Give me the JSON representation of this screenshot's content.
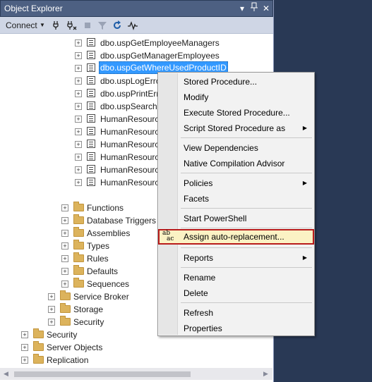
{
  "titlebar": {
    "title": "Object Explorer",
    "pin_glyph": "▾",
    "pin2_glyph": "⊣",
    "close_glyph": "✕"
  },
  "toolbar": {
    "connect_label": "Connect",
    "icons": [
      "connect-icon",
      "disconnect-icon",
      "stop-icon",
      "filter-icon",
      "refresh-icon",
      "activity-monitor-icon"
    ]
  },
  "tree": {
    "items": [
      {
        "label": "dbo.uspGetEmployeeManagers",
        "type": "sp"
      },
      {
        "label": "dbo.uspGetManagerEmployees",
        "type": "sp"
      },
      {
        "label": "dbo.uspGetWhereUsedProductID",
        "type": "sp",
        "selected": true
      },
      {
        "label": "dbo.uspLogErro",
        "type": "sp"
      },
      {
        "label": "dbo.uspPrintErr",
        "type": "sp"
      },
      {
        "label": "dbo.uspSearchC",
        "type": "sp"
      },
      {
        "label": "HumanResourc",
        "type": "sp"
      },
      {
        "label": "HumanResourc",
        "type": "sp"
      },
      {
        "label": "HumanResourc",
        "type": "sp"
      },
      {
        "label": "HumanResourc",
        "type": "sp"
      },
      {
        "label": "HumanResourc",
        "type": "sp"
      },
      {
        "label": "HumanResourc",
        "type": "sp"
      },
      {
        "label": "Functions",
        "type": "folder"
      },
      {
        "label": "Database Triggers",
        "type": "folder"
      },
      {
        "label": "Assemblies",
        "type": "folder"
      },
      {
        "label": "Types",
        "type": "folder"
      },
      {
        "label": "Rules",
        "type": "folder"
      },
      {
        "label": "Defaults",
        "type": "folder"
      },
      {
        "label": "Sequences",
        "type": "folder"
      },
      {
        "label": "Service Broker",
        "type": "folder"
      },
      {
        "label": "Storage",
        "type": "folder"
      },
      {
        "label": "Security",
        "type": "folder"
      },
      {
        "label": "Security",
        "type": "folder"
      },
      {
        "label": "Server Objects",
        "type": "folder"
      },
      {
        "label": "Replication",
        "type": "folder"
      }
    ],
    "expand_glyph": "+"
  },
  "menu": {
    "items": [
      {
        "label": "Stored Procedure..."
      },
      {
        "label": "Modify"
      },
      {
        "label": "Execute Stored Procedure..."
      },
      {
        "label": "Script Stored Procedure as",
        "submenu": true
      },
      {
        "label": "View Dependencies"
      },
      {
        "label": "Native Compilation Advisor"
      },
      {
        "label": "Policies",
        "submenu": true
      },
      {
        "label": "Facets"
      },
      {
        "label": "Start PowerShell"
      },
      {
        "label": "Assign auto-replacement...",
        "highlighted": true,
        "icon": "abc-replace-icon"
      },
      {
        "label": "Reports",
        "submenu": true
      },
      {
        "label": "Rename"
      },
      {
        "label": "Delete"
      },
      {
        "label": "Refresh"
      },
      {
        "label": "Properties"
      }
    ],
    "submenu_glyph": "▶",
    "icon_glyph_top": "ab",
    "icon_glyph_bottom": "ac"
  },
  "colors": {
    "selection": "#3399ff",
    "highlight_border": "#b91c1c",
    "highlight_fill": "#fbf2c4",
    "title_bar": "#4d6082"
  }
}
